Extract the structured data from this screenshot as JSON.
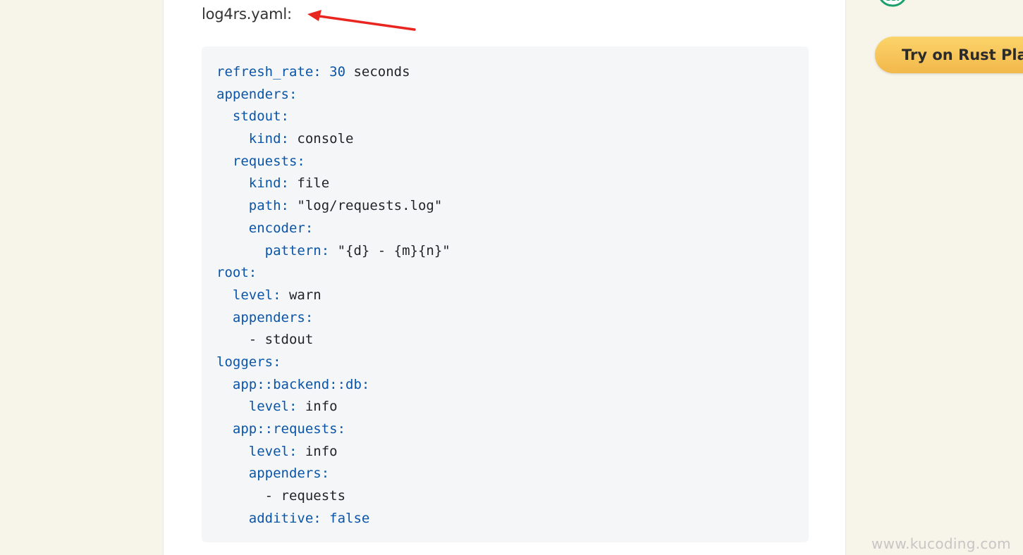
{
  "article": {
    "filename": "log4rs.yaml:"
  },
  "code": {
    "language": "yaml",
    "lines": [
      {
        "indent": "",
        "key": "refresh_rate:",
        "value": " 30",
        "value_type": "num",
        "rest": " seconds"
      },
      {
        "indent": "",
        "key": "appenders:",
        "value": "",
        "value_type": "val",
        "rest": ""
      },
      {
        "indent": "  ",
        "key": "stdout:",
        "value": "",
        "value_type": "val",
        "rest": ""
      },
      {
        "indent": "    ",
        "key": "kind:",
        "value": " console",
        "value_type": "val",
        "rest": ""
      },
      {
        "indent": "  ",
        "key": "requests:",
        "value": "",
        "value_type": "val",
        "rest": ""
      },
      {
        "indent": "    ",
        "key": "kind:",
        "value": " file",
        "value_type": "val",
        "rest": ""
      },
      {
        "indent": "    ",
        "key": "path:",
        "value": " \"log/requests.log\"",
        "value_type": "val",
        "rest": ""
      },
      {
        "indent": "    ",
        "key": "encoder:",
        "value": "",
        "value_type": "val",
        "rest": ""
      },
      {
        "indent": "      ",
        "key": "pattern:",
        "value": " \"{d} - {m}{n}\"",
        "value_type": "val",
        "rest": ""
      },
      {
        "indent": "",
        "key": "root:",
        "value": "",
        "value_type": "val",
        "rest": ""
      },
      {
        "indent": "  ",
        "key": "level:",
        "value": " warn",
        "value_type": "val",
        "rest": ""
      },
      {
        "indent": "  ",
        "key": "appenders:",
        "value": "",
        "value_type": "val",
        "rest": ""
      },
      {
        "indent": "    ",
        "key": "",
        "value": "- stdout",
        "value_type": "val",
        "rest": ""
      },
      {
        "indent": "",
        "key": "loggers:",
        "value": "",
        "value_type": "val",
        "rest": ""
      },
      {
        "indent": "  ",
        "key": "app::backend::db:",
        "value": "",
        "value_type": "val",
        "rest": ""
      },
      {
        "indent": "    ",
        "key": "level:",
        "value": " info",
        "value_type": "val",
        "rest": ""
      },
      {
        "indent": "  ",
        "key": "app::requests:",
        "value": "",
        "value_type": "val",
        "rest": ""
      },
      {
        "indent": "    ",
        "key": "level:",
        "value": " info",
        "value_type": "val",
        "rest": ""
      },
      {
        "indent": "    ",
        "key": "appenders:",
        "value": "",
        "value_type": "val",
        "rest": ""
      },
      {
        "indent": "      ",
        "key": "",
        "value": "- requests",
        "value_type": "val",
        "rest": ""
      },
      {
        "indent": "    ",
        "key": "additive:",
        "value": " false",
        "value_type": "bool",
        "rest": ""
      }
    ]
  },
  "sidebar": {
    "try_button_label": "Try on Rust Play"
  },
  "watermark": {
    "text": "www.kucoding.com"
  },
  "colors": {
    "page_background": "#f7f5e9",
    "code_background": "#f5f6f8",
    "code_key": "#0a55a8",
    "annotation_arrow": "#e8251f",
    "button_gradient_top": "#fbd46a",
    "button_gradient_bottom": "#f2b84b",
    "badge_green": "#1aa06d"
  },
  "icons": {
    "annotation": "red-arrow-icon",
    "badge": "green-badge-icon"
  }
}
